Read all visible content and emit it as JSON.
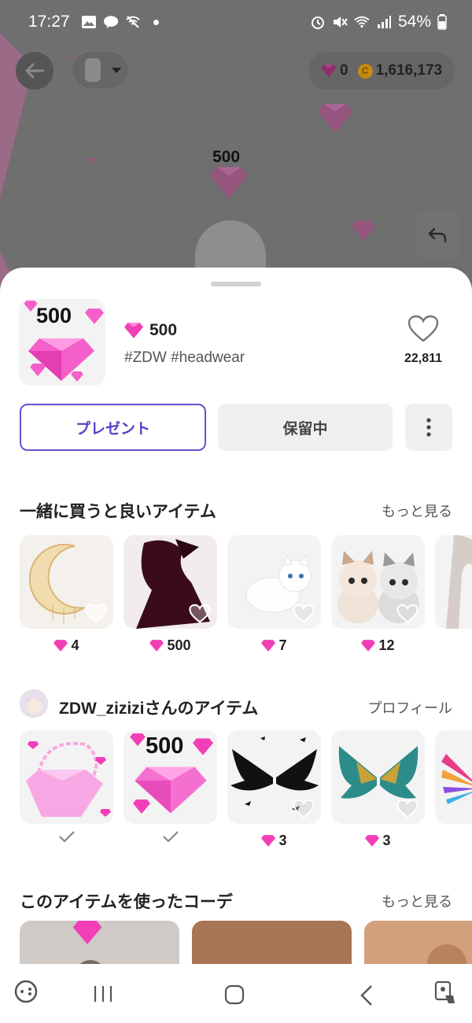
{
  "status_bar": {
    "time": "17:27",
    "battery": "54%"
  },
  "header": {
    "gem_count": "0",
    "coin_count": "1,616,173",
    "coin_symbol": "C"
  },
  "preview": {
    "floating_label": "500"
  },
  "item": {
    "thumb_label": "500",
    "price": "500",
    "tags": "#ZDW #headwear",
    "likes": "22,811"
  },
  "actions": {
    "present_label": "プレゼント",
    "hold_label": "保留中"
  },
  "section_recommended": {
    "title": "一緒に買うと良いアイテム",
    "link": "もっと見る",
    "items": [
      {
        "price": "4"
      },
      {
        "price": "500"
      },
      {
        "price": "7"
      },
      {
        "price": "12"
      },
      {
        "price": ""
      }
    ]
  },
  "section_creator": {
    "title": "ZDW_ziziziさんのアイテム",
    "link": "プロフィール",
    "items": [
      {
        "thumb_label": "",
        "price": ""
      },
      {
        "thumb_label": "500",
        "price": ""
      },
      {
        "thumb_label": "",
        "price": "3"
      },
      {
        "thumb_label": "",
        "price": "3"
      },
      {
        "thumb_label": "",
        "price": ""
      }
    ]
  },
  "section_coordinates": {
    "title": "このアイテムを使ったコーデ",
    "link": "もっと見る"
  },
  "colors": {
    "accent": "#5a3ec8",
    "gem": "#e83fb0",
    "coin": "#c48b12"
  }
}
